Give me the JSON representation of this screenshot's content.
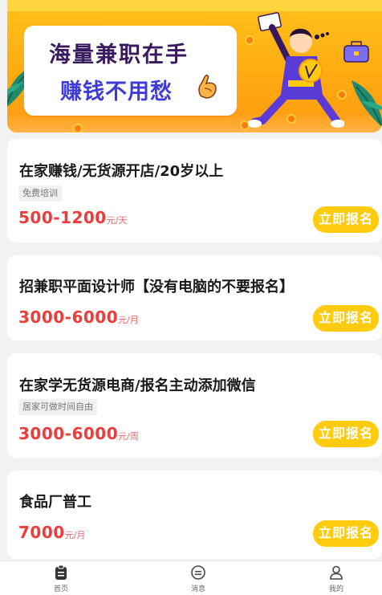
{
  "banner": {
    "line1": "海量兼职在手",
    "line2": "赚钱不用愁"
  },
  "jobs": [
    {
      "title": "在家赚钱/无货源开店/20岁以上",
      "tag": "免费培训",
      "salary": "500-1200",
      "unit": "元/天",
      "apply_label": "立即报名"
    },
    {
      "title": "招兼职平面设计师【没有电脑的不要报名】",
      "tag": "",
      "salary": "3000-6000",
      "unit": "元/月",
      "apply_label": "立即报名"
    },
    {
      "title": "在家学无货源电商/报名主动添加微信",
      "tag": "居家可做时间自由",
      "salary": "3000-6000",
      "unit": "元/周",
      "apply_label": "立即报名"
    },
    {
      "title": "食品厂普工",
      "tag": "",
      "salary": "7000",
      "unit": "元/月",
      "apply_label": "立即报名"
    }
  ],
  "nav": [
    {
      "label": "首页",
      "icon": "clipboard-icon"
    },
    {
      "label": "消息",
      "icon": "message-icon"
    },
    {
      "label": "我的",
      "icon": "user-icon"
    }
  ],
  "colors": {
    "accent": "#ffcb0f",
    "salary": "#ee3b3b",
    "banner": "#ffab12",
    "slogan_dark": "#3a1a5e",
    "slogan_blue": "#3f3bd6"
  }
}
